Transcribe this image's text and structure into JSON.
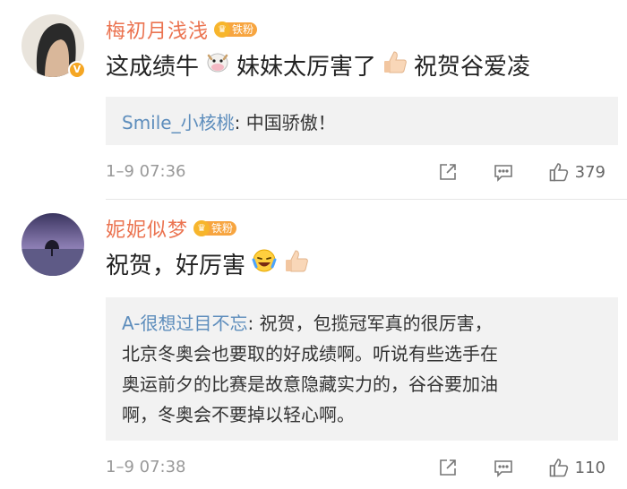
{
  "comments": [
    {
      "username": "梅初月浅浅",
      "fan_badge": "铁粉",
      "text_parts": [
        "这成绩牛",
        "妹妹太厉害了",
        "祝贺谷爱凌"
      ],
      "emojis": [
        "cow-face-emoji",
        "thumbs-up-emoji"
      ],
      "reply": {
        "user": "Smile_小核桃",
        "text": ": 中国骄傲！"
      },
      "time": "1–9 07:36",
      "likes": "379"
    },
    {
      "username": "妮妮似梦",
      "fan_badge": "铁粉",
      "text_parts": [
        "祝贺，好厉害"
      ],
      "emojis": [
        "crying-laughing-emoji",
        "thumbs-up-emoji"
      ],
      "reply": {
        "user": "A-很想过目不忘",
        "text_lines": [
          ": 祝贺，包揽冠军真的很厉害，",
          "北京冬奥会也要取的好成绩啊。听说有些选手在",
          "奥运前夕的比赛是故意隐藏实力的，谷谷要加油",
          "啊，冬奥会不要掉以轻心啊。"
        ]
      },
      "time": "1–9 07:38",
      "likes": "110"
    }
  ],
  "colors": {
    "username": "#eb7350",
    "reply_user": "#5d8dbc",
    "reply_bg": "#f2f2f2",
    "fan_badge": "#f7a540",
    "meta": "#999999"
  }
}
